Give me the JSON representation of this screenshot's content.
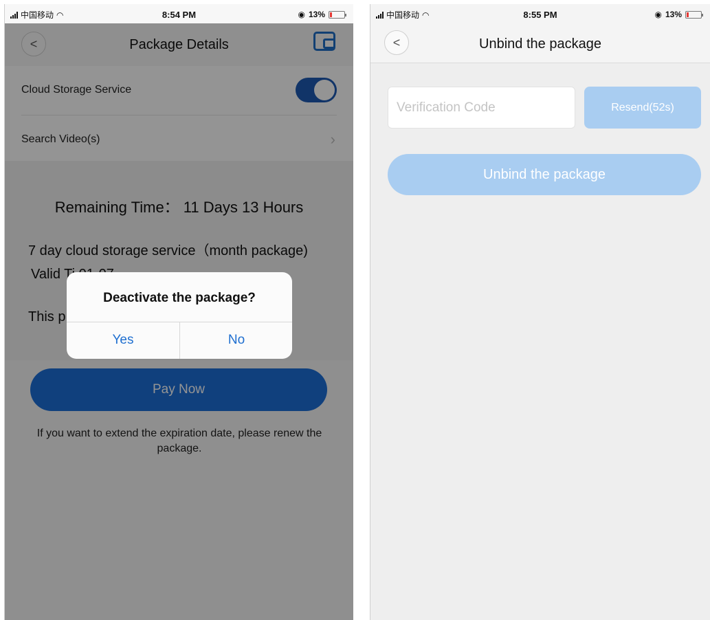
{
  "left": {
    "status": {
      "carrier": "中国移动",
      "time": "8:54 PM",
      "battery": "13%"
    },
    "nav": {
      "back": "<",
      "title": "Package Details"
    },
    "cloud_storage_label": "Cloud Storage Service",
    "cloud_storage_on": true,
    "search_video_label": "Search Video(s)",
    "chevron": "›",
    "remaining_time": "Remaining Time： 11 Days 13 Hours",
    "package_name": "7 day cloud storage service（month package)",
    "valid_time": "Valid Ti                                    01-07",
    "note_partial": "This p                                       ithout",
    "pay_now": "Pay Now",
    "renew_hint": "If you want to extend the expiration date, please renew the package.",
    "dialog": {
      "title": "Deactivate the package?",
      "yes": "Yes",
      "no": "No"
    }
  },
  "right": {
    "status": {
      "carrier": "中国移动",
      "time": "8:55 PM",
      "battery": "13%"
    },
    "nav": {
      "back": "<",
      "title": "Unbind the package"
    },
    "verification_placeholder": "Verification Code",
    "resend": "Resend(52s)",
    "unbind": "Unbind the package"
  },
  "colors": {
    "primary": "#1d6fd8",
    "disabled": "#a9cdf1",
    "alert_link": "#1f6fd0"
  },
  "icons": [
    "signal-icon",
    "wifi-icon",
    "alarm-icon",
    "battery-icon",
    "back-chevron-icon",
    "wallet-icon",
    "chevron-right-icon"
  ]
}
